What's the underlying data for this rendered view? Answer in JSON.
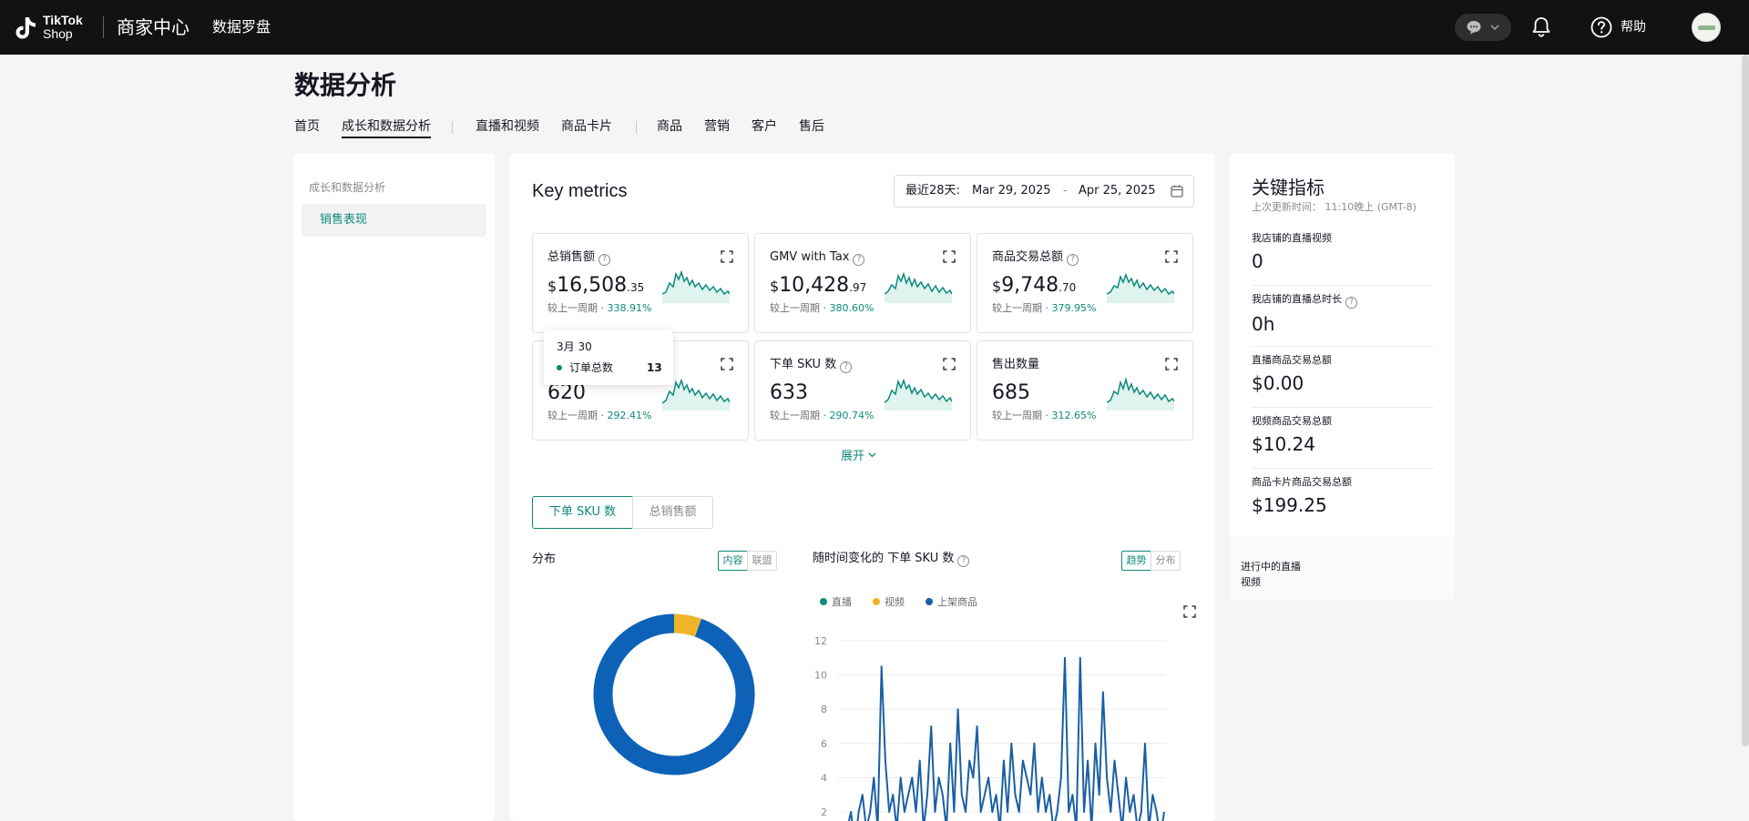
{
  "topbar": {
    "logo_tiktok": "TikTok",
    "logo_shop": "Shop",
    "center_title": "商家中心",
    "compass_title": "数据罗盘",
    "help_label": "帮助"
  },
  "page": {
    "title": "数据分析",
    "tabs": [
      {
        "label": "首页"
      },
      {
        "label": "成长和数据分析",
        "active": true
      },
      {
        "label": "直播和视频"
      },
      {
        "label": "商品卡片"
      },
      {
        "label": "商品"
      },
      {
        "label": "营销"
      },
      {
        "label": "客户"
      },
      {
        "label": "售后"
      }
    ]
  },
  "leftnav": {
    "group_label": "成长和数据分析",
    "items": [
      {
        "label": "销售表现",
        "active": true
      }
    ]
  },
  "main": {
    "title": "Key metrics",
    "date_range": {
      "prefix": "最近28天:",
      "start": "Mar 29, 2025",
      "separator": "-",
      "end": "Apr 25, 2025"
    },
    "metrics": [
      {
        "label": "总销售额",
        "currency": "$",
        "value_int": "16,508",
        "value_dec": ".35",
        "compare_label": "较上一周期",
        "compare_value": "· 338.91%"
      },
      {
        "label": "GMV with Tax",
        "currency": "$",
        "value_int": "10,428",
        "value_dec": ".97",
        "compare_label": "较上一周期",
        "compare_value": "· 380.60%"
      },
      {
        "label": "商品交易总额",
        "currency": "$",
        "value_int": "9,748",
        "value_dec": ".70",
        "compare_label": "较上一周期",
        "compare_value": "· 379.95%"
      },
      {
        "label": "订单总数",
        "currency": "",
        "value_int": "620",
        "value_dec": "",
        "compare_label": "较上一周期",
        "compare_value": "· 292.41%"
      },
      {
        "label": "下单 SKU 数",
        "currency": "",
        "value_int": "633",
        "value_dec": "",
        "compare_label": "较上一周期",
        "compare_value": "· 290.74%"
      },
      {
        "label": "售出数量",
        "currency": "",
        "value_int": "685",
        "value_dec": "",
        "compare_label": "较上一周期",
        "compare_value": "· 312.65%"
      }
    ],
    "tooltip": {
      "date": "3月 30",
      "series": "订单总数",
      "value": "13"
    },
    "expand_label": "展开",
    "metric_toggle": [
      "下单 SKU 数",
      "总销售额"
    ],
    "distribution": {
      "title": "分布",
      "toggle": [
        "内容",
        "联盟"
      ]
    },
    "trend": {
      "title": "随时间变化的 下单 SKU 数",
      "toggle": [
        "趋势",
        "分布"
      ]
    }
  },
  "colors": {
    "accent": "#0c8a7a",
    "topbar_bg": "#121212",
    "series_live": "#0c8a7a",
    "series_video": "#f0b429",
    "series_listing": "#1a5fa3"
  },
  "chart_data": [
    {
      "type": "pie",
      "style": "donut",
      "title": "",
      "categories": [
        "视频",
        "上架商品"
      ],
      "values": [
        5.5,
        94.5
      ],
      "colors": [
        "#f0b429",
        "#0d62b8"
      ]
    },
    {
      "type": "line",
      "title": "随时间变化的 下单 SKU 数",
      "ylim": [
        0,
        12
      ],
      "yticks": [
        2,
        4,
        6,
        8,
        10,
        12
      ],
      "grid": true,
      "legend_position": "top-left",
      "series": [
        {
          "name": "直播",
          "color": "#0c8a7a",
          "values": [
            0,
            0,
            0,
            0,
            0,
            0,
            0,
            0,
            0,
            0,
            0,
            0,
            0,
            0,
            0,
            0,
            0,
            0,
            0,
            0,
            0,
            0,
            0,
            0,
            0,
            0,
            0,
            0,
            0,
            0,
            0,
            0,
            0,
            0,
            0,
            0,
            0,
            0,
            0,
            0,
            0,
            0,
            0,
            0,
            0,
            0,
            0,
            0,
            0,
            0,
            0,
            0,
            0,
            0,
            0,
            0,
            0,
            0,
            0,
            0,
            0,
            0,
            0,
            0,
            0,
            0,
            0,
            0,
            0,
            0,
            0,
            0,
            0,
            0,
            0,
            0,
            0,
            0,
            0,
            0,
            0,
            0,
            0,
            0
          ]
        },
        {
          "name": "视频",
          "color": "#f0b429",
          "values": [
            0,
            0,
            0,
            0,
            0,
            0,
            0,
            0,
            0,
            0,
            0,
            0,
            0,
            0,
            0,
            0,
            0,
            1,
            0,
            0,
            0,
            0,
            0,
            0,
            0,
            0,
            0,
            0,
            0,
            0,
            0,
            0,
            0,
            0,
            0,
            0,
            0,
            0,
            0,
            0,
            0,
            1,
            0,
            0,
            0,
            0,
            0,
            0,
            0,
            0,
            0,
            0,
            0,
            0,
            0,
            0,
            0,
            0,
            0,
            0,
            0,
            0,
            0,
            0,
            0,
            0,
            0,
            0,
            0,
            0,
            0,
            0,
            0,
            0,
            0,
            0,
            0,
            0,
            0,
            0,
            0,
            0,
            0,
            0
          ]
        },
        {
          "name": "上架商品",
          "color": "#1a5fa3",
          "values": [
            1,
            2,
            0,
            2,
            3,
            1,
            2,
            4,
            1,
            10.5,
            5,
            2,
            3,
            1,
            4,
            2,
            3,
            4,
            2,
            5,
            1,
            3,
            7,
            2,
            4,
            3,
            1,
            6,
            2,
            8,
            3,
            2,
            5,
            4,
            7,
            2,
            3,
            4,
            2,
            3,
            1,
            5,
            2,
            6,
            3,
            2,
            5,
            4,
            3,
            6,
            2,
            4,
            2,
            3,
            1,
            2,
            4,
            11,
            2,
            3,
            1,
            11,
            2,
            5,
            1,
            6,
            3,
            9,
            4,
            2,
            5,
            3,
            1,
            4,
            2,
            3,
            1,
            2,
            6,
            1,
            3,
            2,
            0.5,
            2
          ]
        }
      ]
    }
  ],
  "rightcard": {
    "title": "关键指标",
    "subtitle": "上次更新时间： 11:10晚上 (GMT-8)",
    "items": [
      {
        "label": "我店铺的直播视频",
        "value": "0"
      },
      {
        "label": "我店铺的直播总时长",
        "value": "0h"
      },
      {
        "label": "直播商品交易总额",
        "value": "$0.00"
      },
      {
        "label": "视频商品交易总额",
        "value": "$10.24"
      },
      {
        "label": "商品卡片商品交易总额",
        "value": "$199.25"
      }
    ],
    "bottom_label": "进行中的直播视频"
  }
}
